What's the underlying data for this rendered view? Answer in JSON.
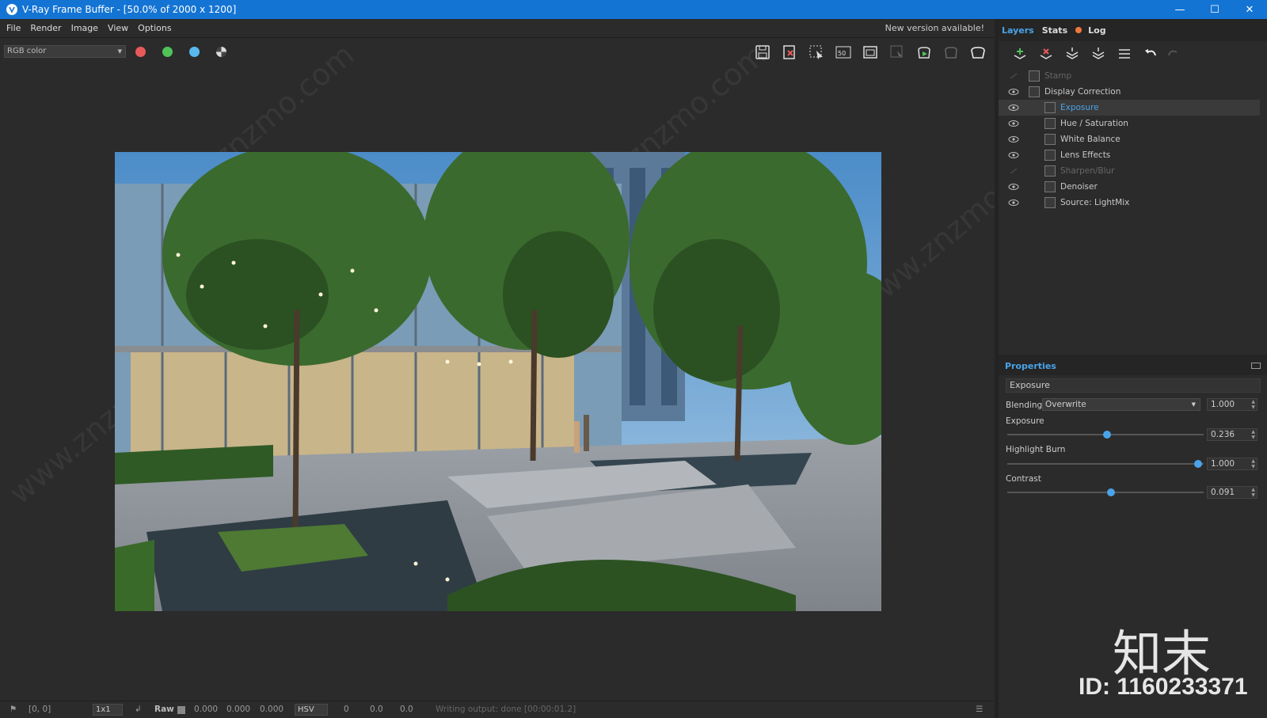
{
  "window": {
    "title": "V-Ray Frame Buffer - [50.0% of 2000 x 1200]"
  },
  "menu": {
    "items": [
      "File",
      "Render",
      "Image",
      "View",
      "Options"
    ],
    "new_version": "New version available!"
  },
  "toolbar": {
    "channel": "RGB color",
    "color_dots": [
      "#e85a5a",
      "#4fc35a",
      "#5ab8ee"
    ],
    "icons": [
      "save-icon",
      "clear-icon",
      "region-render-icon",
      "zoom-50-icon",
      "fit-icon",
      "track-mouse-icon",
      "render-icon",
      "stop-icon",
      "teapot-icon"
    ],
    "zoom_label": "50"
  },
  "tabs": {
    "layers": "Layers",
    "stats": "Stats",
    "log": "Log"
  },
  "layers": [
    {
      "name": "Stamp",
      "visible": false,
      "dim": true,
      "indent": 0
    },
    {
      "name": "Display Correction",
      "visible": true,
      "dim": false,
      "indent": 0
    },
    {
      "name": "Exposure",
      "visible": true,
      "dim": false,
      "indent": 1,
      "selected": true
    },
    {
      "name": "Hue / Saturation",
      "visible": true,
      "dim": false,
      "indent": 1
    },
    {
      "name": "White Balance",
      "visible": true,
      "dim": false,
      "indent": 1
    },
    {
      "name": "Lens Effects",
      "visible": true,
      "dim": false,
      "indent": 1
    },
    {
      "name": "Sharpen/Blur",
      "visible": false,
      "dim": true,
      "indent": 1
    },
    {
      "name": "Denoiser",
      "visible": true,
      "dim": false,
      "indent": 1
    },
    {
      "name": "Source: LightMix",
      "visible": true,
      "dim": false,
      "indent": 1
    }
  ],
  "properties": {
    "title": "Properties",
    "layer_name": "Exposure",
    "blending_label": "Blending",
    "blending_value": "Overwrite",
    "blending_amount": "1.000",
    "exposure_label": "Exposure",
    "exposure_value": "0.236",
    "exposure_level": 0.51,
    "highlight_label": "Highlight Burn",
    "highlight_value": "1.000",
    "highlight_level": 0.97,
    "contrast_label": "Contrast",
    "contrast_value": "0.091",
    "contrast_level": 0.53
  },
  "status": {
    "coords": "[0, 0]",
    "sample": "1x1",
    "raw": "Raw",
    "r": "0.000",
    "g": "0.000",
    "b": "0.000",
    "mode": "HSV",
    "h": "0",
    "s": "0.0",
    "v": "0.0",
    "message": "Writing output: done [00:00:01.2]"
  },
  "brand": {
    "logo": "知末",
    "id": "ID: 1160233371"
  },
  "watermark_text": "www.znzmo.com"
}
